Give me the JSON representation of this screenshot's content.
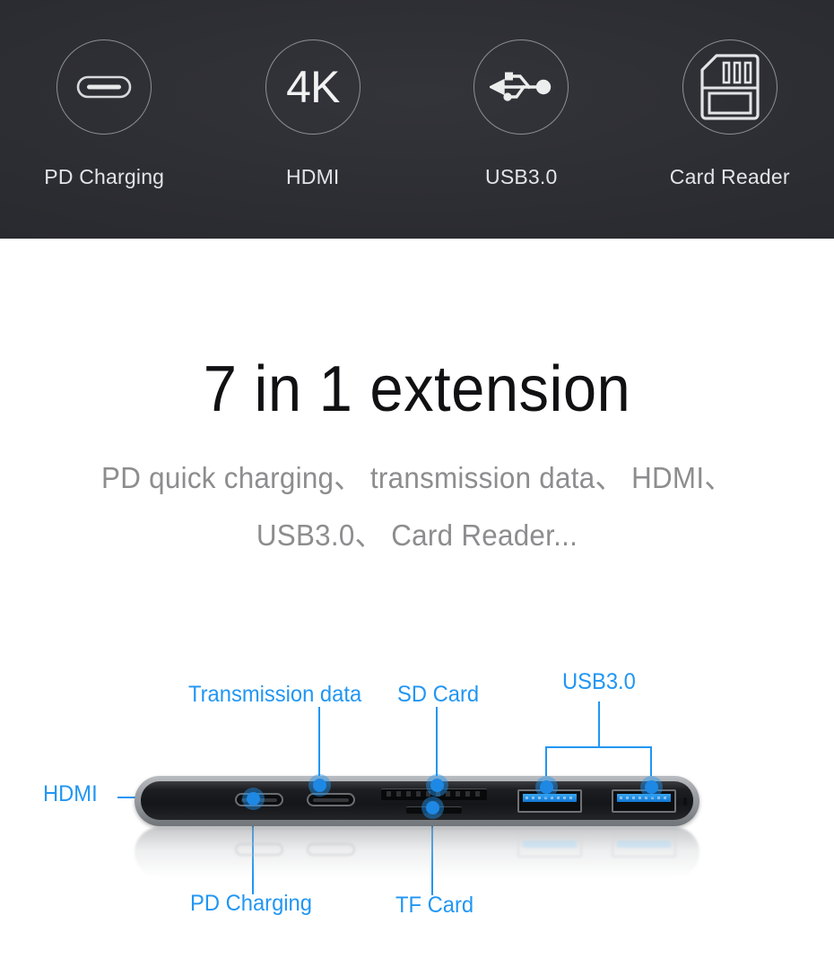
{
  "features": [
    {
      "label": "PD Charging",
      "icon": "usb-c-connector-icon"
    },
    {
      "label": "HDMI",
      "icon": "4k-text-icon",
      "icon_text": "4K"
    },
    {
      "label": "USB3.0",
      "icon": "usb-trident-icon"
    },
    {
      "label": "Card Reader",
      "icon": "sd-card-icon"
    }
  ],
  "headline": "7 in 1 extension",
  "subtitle": {
    "line1": "PD quick charging、 transmission data、 HDMI、",
    "line2": "USB3.0、 Card Reader..."
  },
  "diagram": {
    "callouts": {
      "hdmi": "HDMI",
      "transmission_data": "Transmission data",
      "sd_card": "SD Card",
      "usb30": "USB3.0",
      "pd_charging": "PD Charging",
      "tf_card": "TF Card"
    }
  },
  "colors": {
    "band_background": "#2b2c31",
    "band_text": "#e3e4e6",
    "headline_text": "#111113",
    "subtitle_text": "#8d8d8f",
    "callout_blue": "#2196f3",
    "usb3_port_blue": "#1177d4",
    "device_shell": "#9da1a6",
    "device_face": "#1d1e21"
  }
}
